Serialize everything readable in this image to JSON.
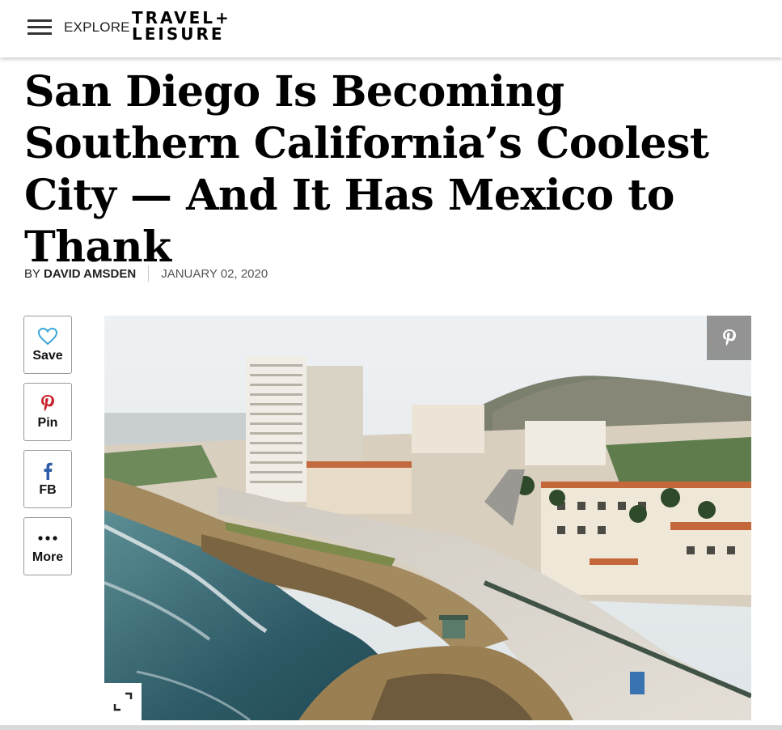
{
  "header": {
    "explore_label": "EXPLORE",
    "logo_line1": "TRAVEL+",
    "logo_line2": "LEISURE"
  },
  "article": {
    "headline": "San Diego Is Becoming Southern California’s Coolest City — And It Has Mexico to Thank",
    "byline_prefix": "BY",
    "author": "DAVID AMSDEN",
    "date": "JANUARY 02, 2020"
  },
  "share": [
    {
      "label": "Save",
      "icon": "heart-icon"
    },
    {
      "label": "Pin",
      "icon": "pinterest-icon"
    },
    {
      "label": "FB",
      "icon": "facebook-icon"
    },
    {
      "label": "More",
      "icon": "more-dots-icon"
    }
  ],
  "hero": {
    "alt_subject": "aerial view of La Jolla coastline",
    "pin_icon": "pinterest-icon",
    "expand_icon": "expand-icon"
  },
  "colors": {
    "save_icon": "#3aa7d6",
    "pin_icon": "#c8232c",
    "fb_icon": "#2f5ba8"
  }
}
